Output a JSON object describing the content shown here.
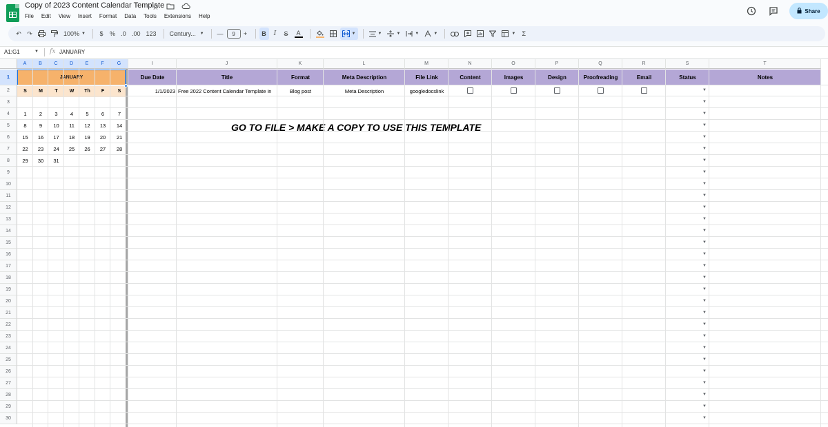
{
  "app": {
    "doc_title": "Copy of 2023 Content Calendar Template",
    "menu": [
      "File",
      "Edit",
      "View",
      "Insert",
      "Format",
      "Data",
      "Tools",
      "Extensions",
      "Help"
    ],
    "share_label": "Share"
  },
  "toolbar": {
    "zoom": "100%",
    "currency": "$",
    "percent": "%",
    "dec_less": ".0",
    "dec_more": ".00",
    "number_format": "123",
    "font": "Century...",
    "font_size": "9",
    "bold": "B",
    "italic": "I",
    "strike": "S",
    "text_color": "A",
    "sum": "Σ"
  },
  "formula_bar": {
    "name_box": "A1:G1",
    "fx": "fx",
    "content": "JANUARY"
  },
  "columns": [
    "A",
    "B",
    "C",
    "D",
    "E",
    "F",
    "G",
    "I",
    "J",
    "K",
    "L",
    "M",
    "N",
    "O",
    "P",
    "Q",
    "R",
    "S",
    "T"
  ],
  "calendar": {
    "month": "JANUARY",
    "weekdays": [
      "S",
      "M",
      "T",
      "W",
      "Th",
      "F",
      "S"
    ],
    "weeks": [
      [
        "1",
        "2",
        "3",
        "4",
        "5",
        "6",
        "7"
      ],
      [
        "8",
        "9",
        "10",
        "11",
        "12",
        "13",
        "14"
      ],
      [
        "15",
        "16",
        "17",
        "18",
        "19",
        "20",
        "21"
      ],
      [
        "22",
        "23",
        "24",
        "25",
        "26",
        "27",
        "28"
      ],
      [
        "29",
        "30",
        "31",
        "",
        "",
        "",
        ""
      ]
    ]
  },
  "headers": [
    "Due Date",
    "Title",
    "Format",
    "Meta Description",
    "File Link",
    "Content",
    "Images",
    "Design",
    "Proofreading",
    "Email",
    "Status",
    "Notes"
  ],
  "row2": {
    "due_date": "1/1/2023",
    "title": "Free 2022 Content Calendar Template in",
    "format": "Blog post",
    "meta": "Meta Description",
    "file_link": "googledocslink"
  },
  "banner": "GO TO FILE > MAKE A COPY TO USE THIS TEMPLATE",
  "row_numbers": [
    "1",
    "2",
    "3",
    "4",
    "5",
    "6",
    "7",
    "8",
    "9",
    "10",
    "11",
    "12",
    "13",
    "14",
    "15",
    "16",
    "17",
    "18",
    "19",
    "20",
    "21",
    "22",
    "23",
    "24",
    "25",
    "26",
    "27",
    "28",
    "29",
    "30"
  ],
  "colors": {
    "calendar_header": "#f6b26b",
    "weekday_row": "#fce5cd",
    "table_header": "#b4a7d6",
    "share_button": "#c2e7ff"
  }
}
